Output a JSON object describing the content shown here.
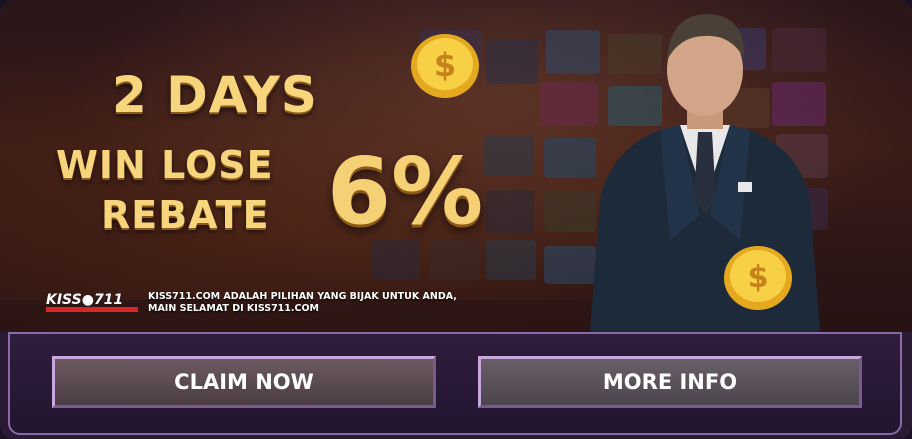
{
  "banner": {
    "headline_line1": "2 DAYS",
    "headline_line2": "WIN LOSE",
    "headline_line3": "REBATE",
    "percent": "6%",
    "logo_text": "KISS●711",
    "tagline_line1": "KISS711.COM ADALAH PILIHAN YANG BIJAK UNTUK ANDA,",
    "tagline_line2": "MAIN SELAMAT DI KISS711.COM"
  },
  "actions": {
    "claim_label": "CLAIM NOW",
    "info_label": "MORE INFO"
  },
  "colors": {
    "gold": "#f6d57c",
    "frame": "#8a6aa8",
    "button_border": "#c8a8dc"
  }
}
